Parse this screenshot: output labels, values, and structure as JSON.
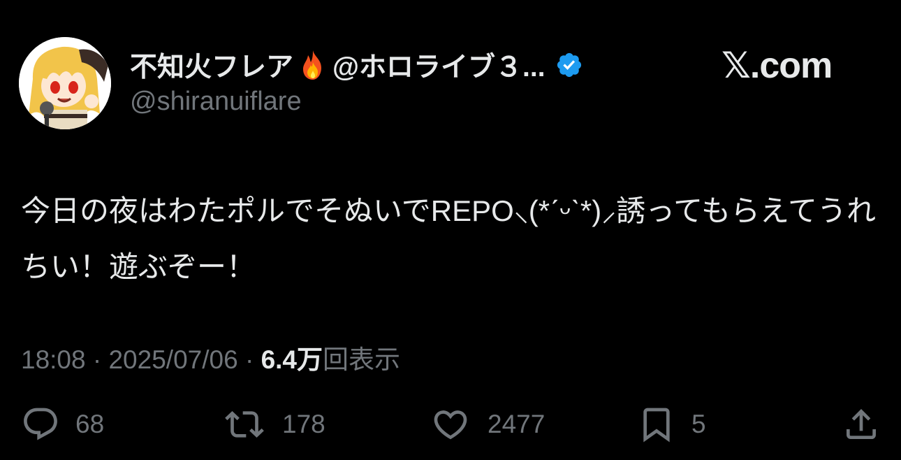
{
  "header": {
    "display_name": "不知火フレア",
    "display_name_suffix": "@ホロライブ３...",
    "handle": "@shiranuiflare",
    "icons": [
      "fire-icon",
      "verified-icon"
    ],
    "brand": "𝕏.com"
  },
  "tweet": {
    "text": "今日の夜はわたポルでそぬいでREPO⸜(*ˊᵕˋ*)⸝誘ってもらえてうれちい！遊ぶぞー！"
  },
  "meta": {
    "time": "18:08",
    "separator1": " · ",
    "date": "2025/07/06",
    "separator2": " · ",
    "views_count": "6.4万",
    "views_label": "回表示"
  },
  "actions": {
    "replies": "68",
    "reposts": "178",
    "likes": "2477",
    "bookmarks": "5"
  },
  "colors": {
    "background": "#000000",
    "text_primary": "#e7e9ea",
    "text_secondary": "#71767b",
    "verified": "#1d9bf0"
  }
}
